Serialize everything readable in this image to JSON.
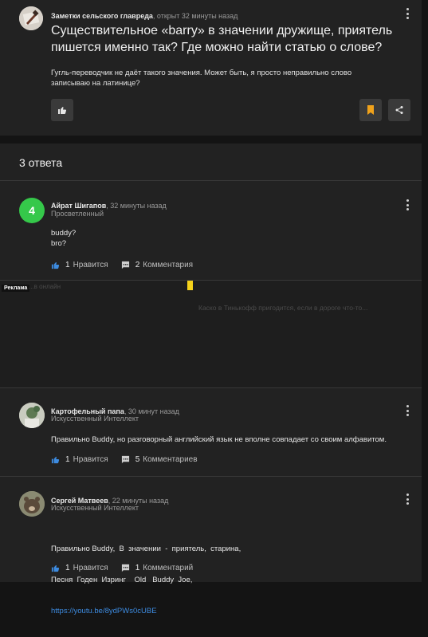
{
  "question": {
    "author": "Заметки сельского главреда",
    "meta": ", открыт 32 минуты назад",
    "title": "Существительное «barry» в значении дружище, приятель пишется именно так? Где можно найти статью о слове?",
    "body": "Гугль-переводчик не даёт такого значения. Может быть, я просто неправильно слово записываю на латинице?",
    "accent_color": "#f0a21b"
  },
  "answers_header": "3 ответа",
  "answers": [
    {
      "author": "Айрат Шигапов",
      "time": ", 32 минуты назад",
      "role": "Просветленный",
      "avatar_letter": "4",
      "avatar_color": "#35c84a",
      "lines": [
        "buddy?",
        "bro?"
      ],
      "likes": "1",
      "like_label": "Нравится",
      "comments": "2",
      "comments_label": "Комментария"
    },
    {
      "author": "Картофельный папа",
      "time": ", 30 минут назад",
      "role": "Искусственный Интеллект",
      "text": "Правильно Buddy, но разговорный английский язык не вполне совпадает со своим алфавитом.",
      "likes": "1",
      "like_label": "Нравится",
      "comments": "5",
      "comments_label": "Комментариев"
    },
    {
      "author": "Сергей Матвеев",
      "time": ", 22 минуты назад",
      "role": "Искусственный Интеллект",
      "line1": "Правильно Buddy,  В  значении  -  приятель,  старина,",
      "line2": "Песня  Годен  Изринг    Old   Buddy  Joe,",
      "link": "https://youtu.be/8ydPWs0cUBE",
      "likes": "1",
      "like_label": "Нравится",
      "comments": "1",
      "comments_label": "Комментарий"
    }
  ],
  "ad": {
    "badge": "Реклама",
    "faint_left": "...в онлайн",
    "faint_text": "Каско в Тинькофф пригодится, если в дороге что-то...",
    "marker_color": "#f5d21b"
  }
}
